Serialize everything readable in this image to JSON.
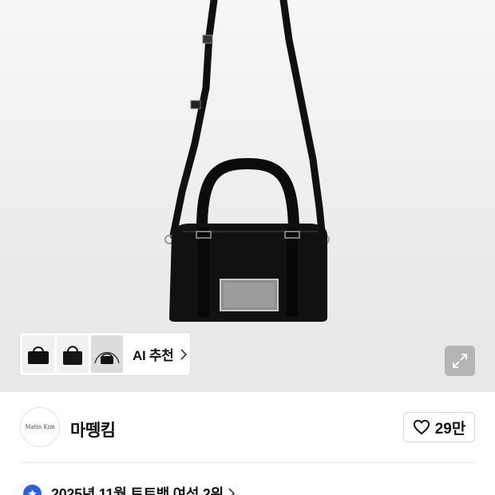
{
  "product": {
    "image_alt": "Matin Kim black mini tote bag"
  },
  "recommendation": {
    "thumbnails": [
      "bag-front",
      "bag-front-glossy",
      "bag-with-strap"
    ],
    "label": "AI 추천"
  },
  "brand": {
    "logo_text": "Matin Kim",
    "name": "마뗑킴"
  },
  "like": {
    "count": "29만"
  },
  "ranking": {
    "text": "2025년 11월 토트백 여성 2위"
  },
  "colors": {
    "accent_badge": "#2a5ee8",
    "bag": "#111111"
  }
}
